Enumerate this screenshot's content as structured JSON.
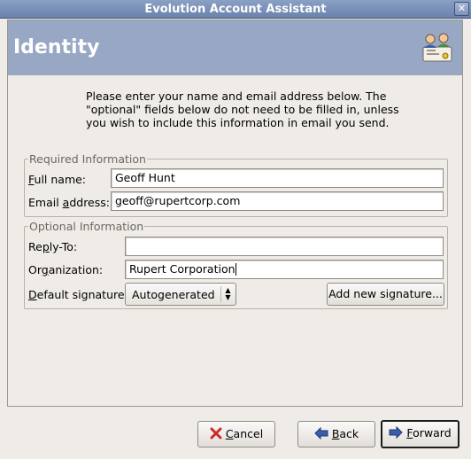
{
  "window": {
    "title": "Evolution Account Assistant"
  },
  "page": {
    "heading": "Identity",
    "intro": "Please enter your name and email address below. The \"optional\" fields below do not need to be filled in, unless you wish to include this information in email you send."
  },
  "required": {
    "group_title": "Required Information",
    "full_name_label_ul": "F",
    "full_name_label_rest": "ull name:",
    "full_name_value": "Geoff Hunt",
    "email_label_pre": "Email ",
    "email_label_ul": "a",
    "email_label_rest": "ddress:",
    "email_value": "geoff@rupertcorp.com"
  },
  "optional": {
    "group_title": "Optional Information",
    "reply_to_label_pre": "Re",
    "reply_to_label_ul": "p",
    "reply_to_label_rest": "ly-To:",
    "reply_to_value": "",
    "org_label_pre": "Or",
    "org_label_ul": "g",
    "org_label_rest": "anization:",
    "org_value": "Rupert Corporation",
    "signature_label_ul": "D",
    "signature_label_rest": "efault signature:",
    "signature_value": "Autogenerated",
    "add_signature_label": "Add new signature..."
  },
  "buttons": {
    "cancel_ul": "C",
    "cancel_rest": "ancel",
    "back_ul": "B",
    "back_rest": "ack",
    "forward_ul": "F",
    "forward_rest": "orward"
  },
  "icons": {
    "close": "close-icon",
    "minimize": "minimize-icon",
    "maximize": "maximize-icon",
    "cancel": "cancel-icon",
    "back": "back-arrow-icon",
    "forward": "forward-arrow-icon",
    "logo": "evolution-assistant-icon"
  },
  "colors": {
    "titlebar": "#7e93bb",
    "header_band": "#98a7c4",
    "cancel_icon": "#cc2a2a",
    "arrow_icon": "#3a5ea8"
  }
}
